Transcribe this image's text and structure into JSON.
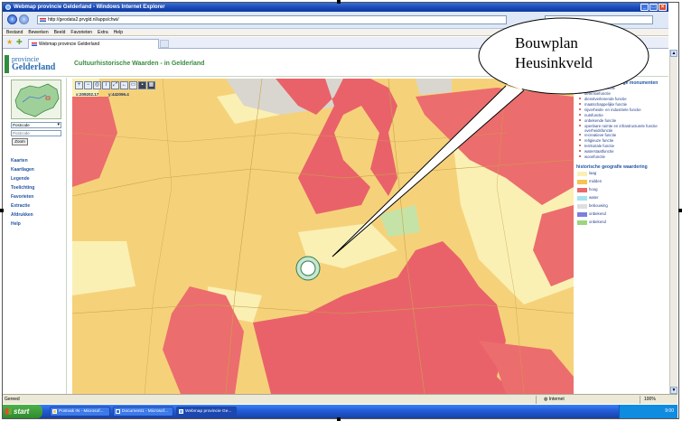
{
  "window": {
    "title": "Webmap provincie Gelderland - Windows Internet Explorer",
    "buttons": [
      "_",
      "□",
      "×"
    ]
  },
  "address_bar": {
    "url": "http://geodata2.prvgld.nl/apps/chwi/"
  },
  "menu": [
    "Bestand",
    "Bewerken",
    "Beeld",
    "Favorieten",
    "Extra",
    "Help"
  ],
  "tab": {
    "label": "Webmap provincie Gelderland"
  },
  "page": {
    "logo_line1": "provincie",
    "logo_line2": "Gelderland",
    "title": "Cultuurhistorische Waarden - in Gelderland"
  },
  "sidebar": {
    "select_value": "Postcode",
    "input_placeholder": "Postcode",
    "zoom_button": "Zoom",
    "nav": [
      "Kaarten",
      "Kaartlagen",
      "Legende",
      "Toelichting",
      "Favorieten",
      "Extractie",
      "Afdrukken",
      "Help"
    ]
  },
  "map": {
    "coord_x": "x:209202.17",
    "coord_y": "y:442096.4",
    "tool_icons": [
      "zoom-in",
      "zoom-out",
      "zoom-box",
      "info",
      "full-extent",
      "previous",
      "measure",
      "select",
      "layers"
    ]
  },
  "legend": {
    "heading1": "historisch bouwkundige monumenten",
    "items": [
      "agrarische functie",
      "defensiefunctie",
      "dienstverlenende functie",
      "maatschappelijke functie",
      "nijverheids- en industriele functie",
      "nutsfunctie",
      "onbekende functie",
      "openbare ruimte en infrastructurele functie overheidsfunctie",
      "recreatieve functie",
      "religieuze functie",
      "territoriale functie",
      "waterstaatfunctie",
      "woonfunctie"
    ],
    "heading2": "historische geografie waardering",
    "swatches": [
      {
        "label": "laag",
        "color": "#fbf0b4"
      },
      {
        "label": "midden",
        "color": "#f5c451"
      },
      {
        "label": "hoog",
        "color": "#e96a6a"
      },
      {
        "label": "water",
        "color": "#a6e3f0"
      },
      {
        "label": "bebouwing",
        "color": "#dedede"
      },
      {
        "label": "onbekend",
        "color": "#7b7fe0"
      },
      {
        "label": "onbekend",
        "color": "#9bd67f"
      }
    ]
  },
  "status": {
    "left": "Gereed",
    "zone": "Internet",
    "zoom": "100%"
  },
  "taskbar": {
    "start": "start",
    "tasks": [
      "Postvak IN - Microsof...",
      "Document1 - Microsof...",
      "Webmap provincie Ge..."
    ],
    "clock": "9:00"
  },
  "callout": {
    "line1": "Bouwplan",
    "line2": "Heusinkveld"
  }
}
